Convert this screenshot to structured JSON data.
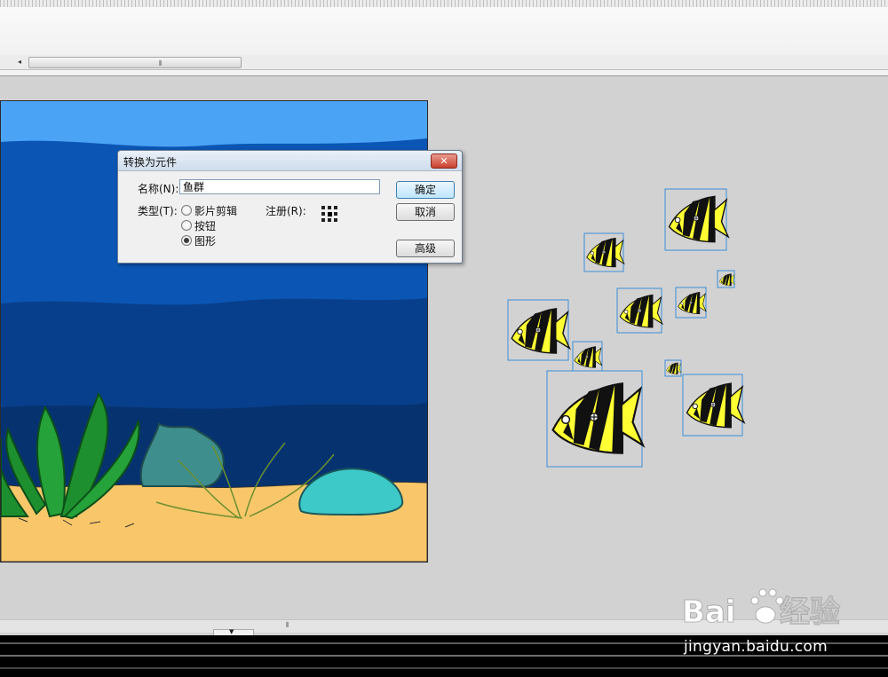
{
  "scrollbar": {
    "grip": "⦀",
    "left_arrow": "◂"
  },
  "dialog": {
    "title": "转换为元件",
    "close_label": "✕",
    "name_label": "名称(N):",
    "name_value": "鱼群",
    "type_label": "类型(T):",
    "types": [
      {
        "label": "影片剪辑",
        "checked": false
      },
      {
        "label": "按钮",
        "checked": false
      },
      {
        "label": "图形",
        "checked": true
      }
    ],
    "registration_label": "注册(R):",
    "ok_label": "确定",
    "cancel_label": "取消",
    "advanced_label": "高级"
  },
  "watermark": {
    "text": "jingyan.baidu.com",
    "brand": "Baidu经验"
  },
  "colors": {
    "stage_sky": "#4aa3f5",
    "stage_sea_1": "#0b56b4",
    "stage_sea_2": "#083f8c",
    "stage_sea_3": "#06336f",
    "stage_sand": "#f9c76a",
    "fish_body": "#ffff33",
    "fish_stripe": "#111111",
    "selection_box": "#3b8fd8",
    "seaweed": "#1e8f2e",
    "rock": "#3f8e8e",
    "pebble": "#3ec9c9"
  }
}
